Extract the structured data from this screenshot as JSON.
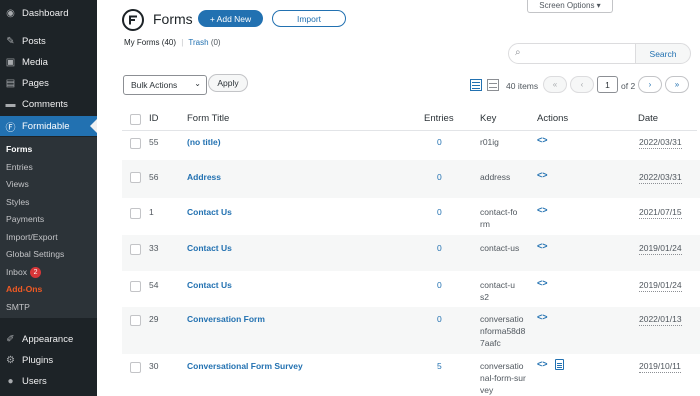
{
  "sidebar": {
    "top_items": [
      {
        "label": "Dashboard",
        "icon": "dashboard-icon",
        "glyph": "◉"
      },
      {
        "label": "Posts",
        "icon": "pin-icon",
        "glyph": "✎"
      },
      {
        "label": "Media",
        "icon": "media-icon",
        "glyph": "▣"
      },
      {
        "label": "Pages",
        "icon": "pages-icon",
        "glyph": "▤"
      },
      {
        "label": "Comments",
        "icon": "comments-icon",
        "glyph": "▬"
      }
    ],
    "active": {
      "label": "Formidable",
      "icon": "formidable-icon",
      "glyph": "Ⓕ"
    },
    "sub_items": [
      "Forms",
      "Entries",
      "Views",
      "Styles",
      "Payments",
      "Import/Export",
      "Global Settings",
      "Inbox",
      "Add-Ons",
      "SMTP"
    ],
    "inbox_badge": "2",
    "bottom_items": [
      {
        "label": "Appearance",
        "icon": "appearance-icon",
        "glyph": "✐"
      },
      {
        "label": "Plugins",
        "icon": "plugins-icon",
        "glyph": "⚙"
      },
      {
        "label": "Users",
        "icon": "users-icon",
        "glyph": "●"
      }
    ]
  },
  "header": {
    "screen_options": "Screen Options ▾",
    "title": "Forms",
    "add_new": "+ Add New",
    "import": "Import"
  },
  "views": {
    "my_forms": "My Forms",
    "my_forms_count": "(40)",
    "separator": "|",
    "trash": "Trash",
    "trash_count": "(0)"
  },
  "search": {
    "button": "Search",
    "placeholder": "",
    "value": ""
  },
  "toolbar": {
    "bulk_actions": "Bulk Actions",
    "apply": "Apply",
    "items_count": "40 items"
  },
  "pagination": {
    "first": "«",
    "prev": "‹",
    "current": "1",
    "of": "of 2",
    "next": "›",
    "last": "»"
  },
  "table": {
    "columns": [
      "ID",
      "Form Title",
      "Entries",
      "Key",
      "Actions",
      "Date"
    ],
    "rows": [
      {
        "id": "55",
        "title": "(no title)",
        "entries": "0",
        "key": "r01ig",
        "date": "2022/03/31",
        "has_doc": false
      },
      {
        "id": "56",
        "title": "Address",
        "entries": "0",
        "key": "address",
        "date": "2022/03/31",
        "has_doc": false
      },
      {
        "id": "1",
        "title": "Contact Us",
        "entries": "0",
        "key": "contact-form",
        "date": "2021/07/15",
        "has_doc": false
      },
      {
        "id": "33",
        "title": "Contact Us",
        "entries": "0",
        "key": "contact-us",
        "date": "2019/01/24",
        "has_doc": false
      },
      {
        "id": "54",
        "title": "Contact Us",
        "entries": "0",
        "key": "contact-us2",
        "date": "2019/01/24",
        "has_doc": false
      },
      {
        "id": "29",
        "title": "Conversation Form",
        "entries": "0",
        "key": "conversationforma58d87aafc",
        "date": "2022/01/13",
        "has_doc": false
      },
      {
        "id": "30",
        "title": "Conversational Form Survey",
        "entries": "5",
        "key": "conversational-form-survey",
        "date": "2019/10/11",
        "has_doc": true
      }
    ],
    "action_glyph": "<>"
  },
  "colors": {
    "accent": "#2271b1",
    "sidebar_bg": "#1d2327",
    "addons": "#f05a24",
    "badge": "#d63638"
  }
}
